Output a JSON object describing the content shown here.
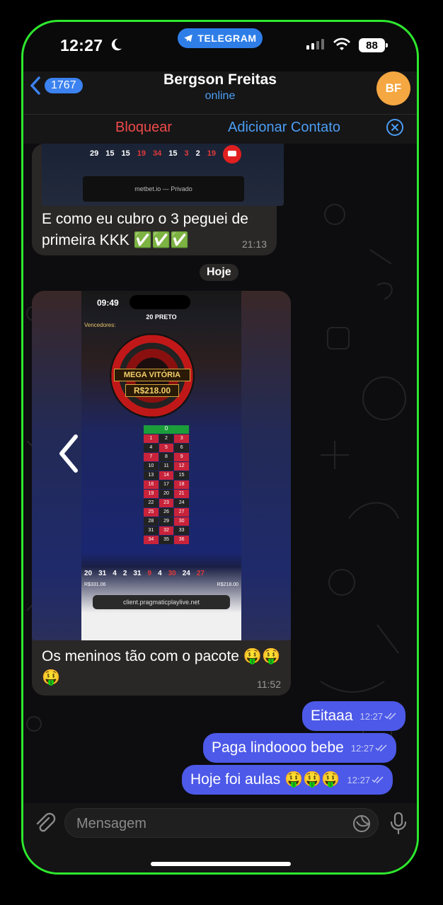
{
  "status_bar": {
    "time": "12:27",
    "pill": "TELEGRAM",
    "battery": "88"
  },
  "header": {
    "back_count": "1767",
    "contact_name": "Bergson Freitas",
    "status": "online",
    "avatar_initials": "BF"
  },
  "action_bar": {
    "block": "Bloquear",
    "add_contact": "Adicionar Contato"
  },
  "messages": [
    {
      "text": "E como eu cubro o 3 peguei de primeira KKK ✅✅✅",
      "time": "21:13"
    },
    {
      "text": "Os meninos tão com o pacote 🤑🤑🤑",
      "time": "11:52"
    }
  ],
  "date_separator": "Hoje",
  "outgoing": [
    {
      "text": "Eitaaa",
      "time": "12:27"
    },
    {
      "text": "Paga lindoooo bebe",
      "time": "12:27"
    },
    {
      "text": "Hoje foi aulas 🤑🤑🤑",
      "time": "12:27"
    }
  ],
  "screenshot1": {
    "numbers": [
      "29",
      "15",
      "15",
      "19",
      "34",
      "15",
      "3",
      "2",
      "19"
    ],
    "url": "metbet.io — Privado"
  },
  "screenshot2": {
    "time": "09:49",
    "result": "20 PRETO",
    "winners": "Vencedores:",
    "mega": "MEGA VITÓRIA",
    "amount": "R$218.00",
    "numbers": [
      "20",
      "31",
      "4",
      "2",
      "31",
      "9",
      "4",
      "30",
      "24",
      "27"
    ],
    "balance": "R$331.06",
    "won": "R$218.00",
    "url": "client.pragmaticplaylive.net"
  },
  "composer": {
    "placeholder": "Mensagem"
  },
  "colors": {
    "frame": "#2ee82e",
    "outgoing": "#4d59e8",
    "accent": "#4b9df5",
    "danger": "#f04a4a",
    "avatar": "#f5a741"
  }
}
